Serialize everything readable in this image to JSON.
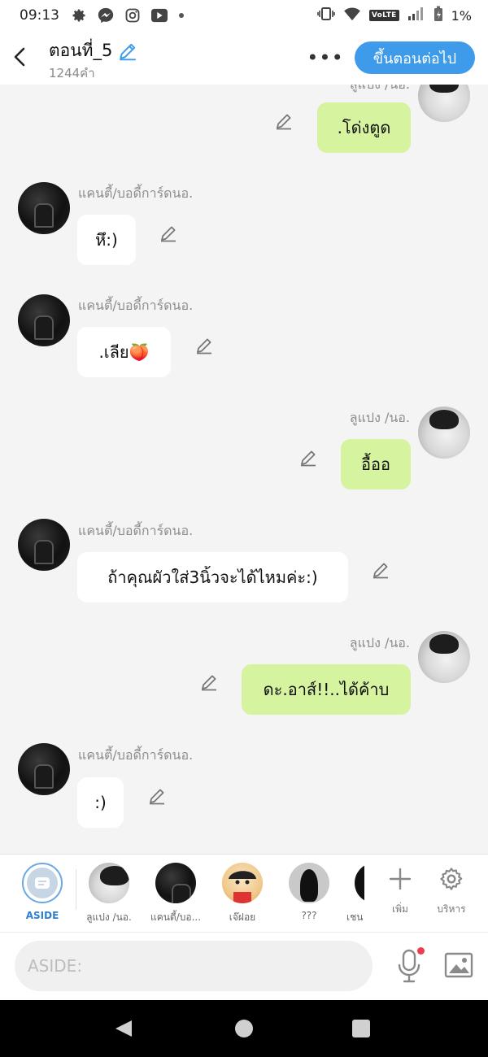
{
  "status_bar": {
    "time": "09:13",
    "battery": "1%",
    "network_badge": "VoLTE"
  },
  "header": {
    "title": "ตอนที่_5",
    "word_count": "1244คำ",
    "more_label": "•••",
    "next_button": "ขึ้นตอนต่อไป"
  },
  "messages": [
    {
      "side": "right",
      "sender": "ลูแปง /นอ.",
      "text": ".โด่งตูด"
    },
    {
      "side": "left",
      "sender": "แคนตี้/บอดี้การ์ดนอ.",
      "text": "หึ:)"
    },
    {
      "side": "left",
      "sender": "แคนตี้/บอดี้การ์ดนอ.",
      "text": ".เลีย🍑"
    },
    {
      "side": "right",
      "sender": "ลูแปง /นอ.",
      "text": "อื้ออ"
    },
    {
      "side": "left",
      "sender": "แคนตี้/บอดี้การ์ดนอ.",
      "text": "ถ้าคุณผัวใส่3นิ้วจะได้ไหมค่ะ:)"
    },
    {
      "side": "right",
      "sender": "ลูแปง /นอ.",
      "text": "ดะ.อาส์!!..ได้ค้าบ"
    },
    {
      "side": "left",
      "sender": "แคนตี้/บอดี้การ์ดนอ.",
      "text": ":)"
    }
  ],
  "characters": [
    {
      "label": "ASIDE"
    },
    {
      "label": "ลูแปง /นอ."
    },
    {
      "label": "แคนตี้/บอ..."
    },
    {
      "label": "เจ๊ฝอย"
    },
    {
      "label": "???"
    },
    {
      "label": "เชน"
    }
  ],
  "tools": {
    "add": "เพิ่ม",
    "manage": "บริหาร"
  },
  "input": {
    "placeholder": "ASIDE:"
  },
  "colors": {
    "accent": "#3d9bea",
    "right_bubble": "#d6f3a0",
    "left_bubble": "#ffffff",
    "background": "#f4f4f4"
  }
}
